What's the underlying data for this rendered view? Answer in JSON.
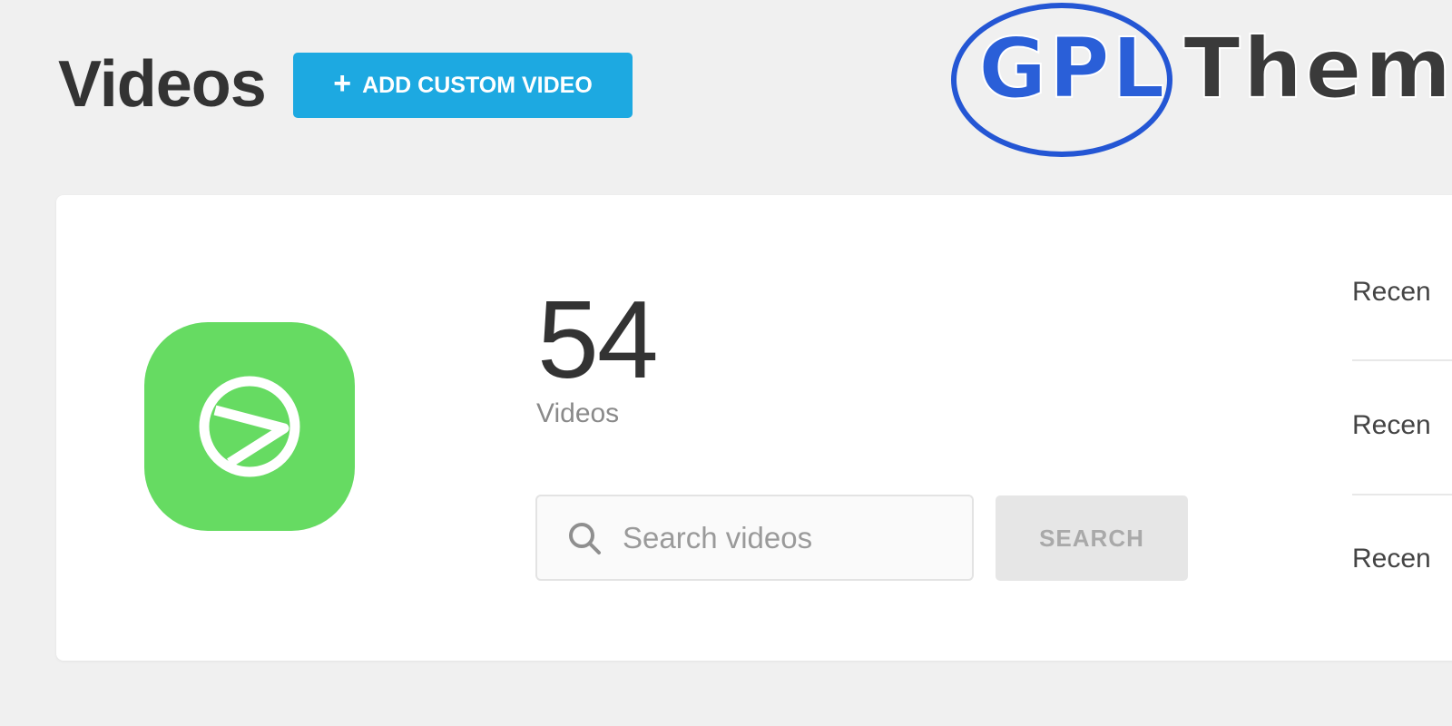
{
  "header": {
    "title": "Videos",
    "add_button_label": "ADD CUSTOM VIDEO",
    "add_button_icon": "plus-icon"
  },
  "watermark": {
    "logo_text_1": "GPL",
    "logo_text_2": "Them"
  },
  "summary": {
    "app_icon": "play-circle-icon",
    "app_icon_color": "#66db62",
    "count": "54",
    "count_label": "Videos"
  },
  "search": {
    "placeholder": "Search videos",
    "value": "",
    "button_label": "SEARCH"
  },
  "recent": {
    "items": [
      {
        "label": "Recen"
      },
      {
        "label": "Recen"
      },
      {
        "label": "Recen"
      }
    ]
  },
  "colors": {
    "accent": "#1da9e1",
    "background": "#f0f0f0",
    "card": "#ffffff"
  }
}
